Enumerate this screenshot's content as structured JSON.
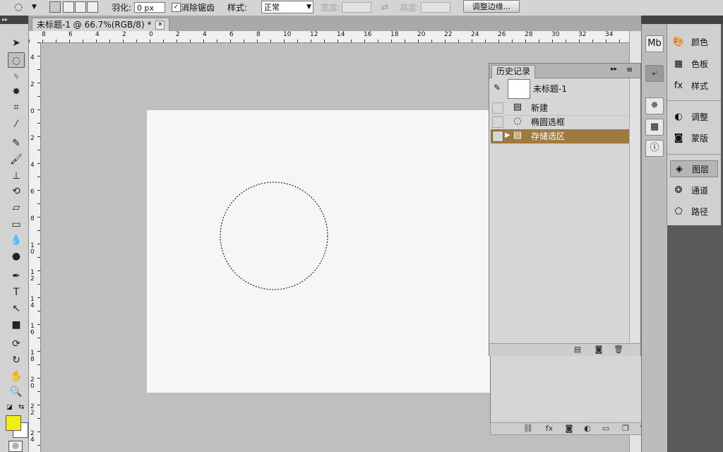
{
  "options_bar": {
    "feather_label": "羽化:",
    "feather_value": "0 px",
    "antialias_label": "消除锯齿",
    "style_label": "样式:",
    "style_value": "正常",
    "width_label": "宽度:",
    "height_label": "高度:",
    "refine_edge_button": "调整边缘..."
  },
  "document": {
    "tab_title": "未标题-1 @ 66.7%(RGB/8) *",
    "ruler_top": [
      "8",
      "6",
      "4",
      "2",
      "0",
      "2",
      "4",
      "6",
      "8",
      "10",
      "12",
      "14",
      "16",
      "18",
      "20",
      "22",
      "24",
      "26",
      "28",
      "30",
      "32",
      "34"
    ],
    "ruler_left": [
      "4",
      "2",
      "0",
      "2",
      "4",
      "6",
      "8",
      "1 0",
      "1 2",
      "1 4",
      "1 6",
      "1 8",
      "2 0",
      "2 2",
      "2 4"
    ]
  },
  "history_panel": {
    "title": "历史记录",
    "snapshot_label": "未标题-1",
    "items": [
      {
        "label": "新建",
        "icon": "document-icon"
      },
      {
        "label": "椭圆选框",
        "icon": "ellipse-marquee-icon"
      },
      {
        "label": "存储选区",
        "icon": "document-icon",
        "selected": true
      }
    ]
  },
  "right_panels": [
    {
      "label": "颜色",
      "icon": "color-palette-icon"
    },
    {
      "label": "色板",
      "icon": "swatches-icon"
    },
    {
      "label": "样式",
      "icon": "styles-icon"
    },
    {
      "label": "调整",
      "icon": "adjustments-icon"
    },
    {
      "label": "蒙版",
      "icon": "masks-icon"
    },
    {
      "label": "图层",
      "icon": "layers-icon",
      "active": true
    },
    {
      "label": "通道",
      "icon": "channels-icon"
    },
    {
      "label": "路径",
      "icon": "paths-icon"
    }
  ],
  "colors": {
    "foreground": "#f2ef10",
    "background": "#ffffff",
    "history_selected": "#9d7a3f",
    "canvas": "#f6f6f8"
  }
}
